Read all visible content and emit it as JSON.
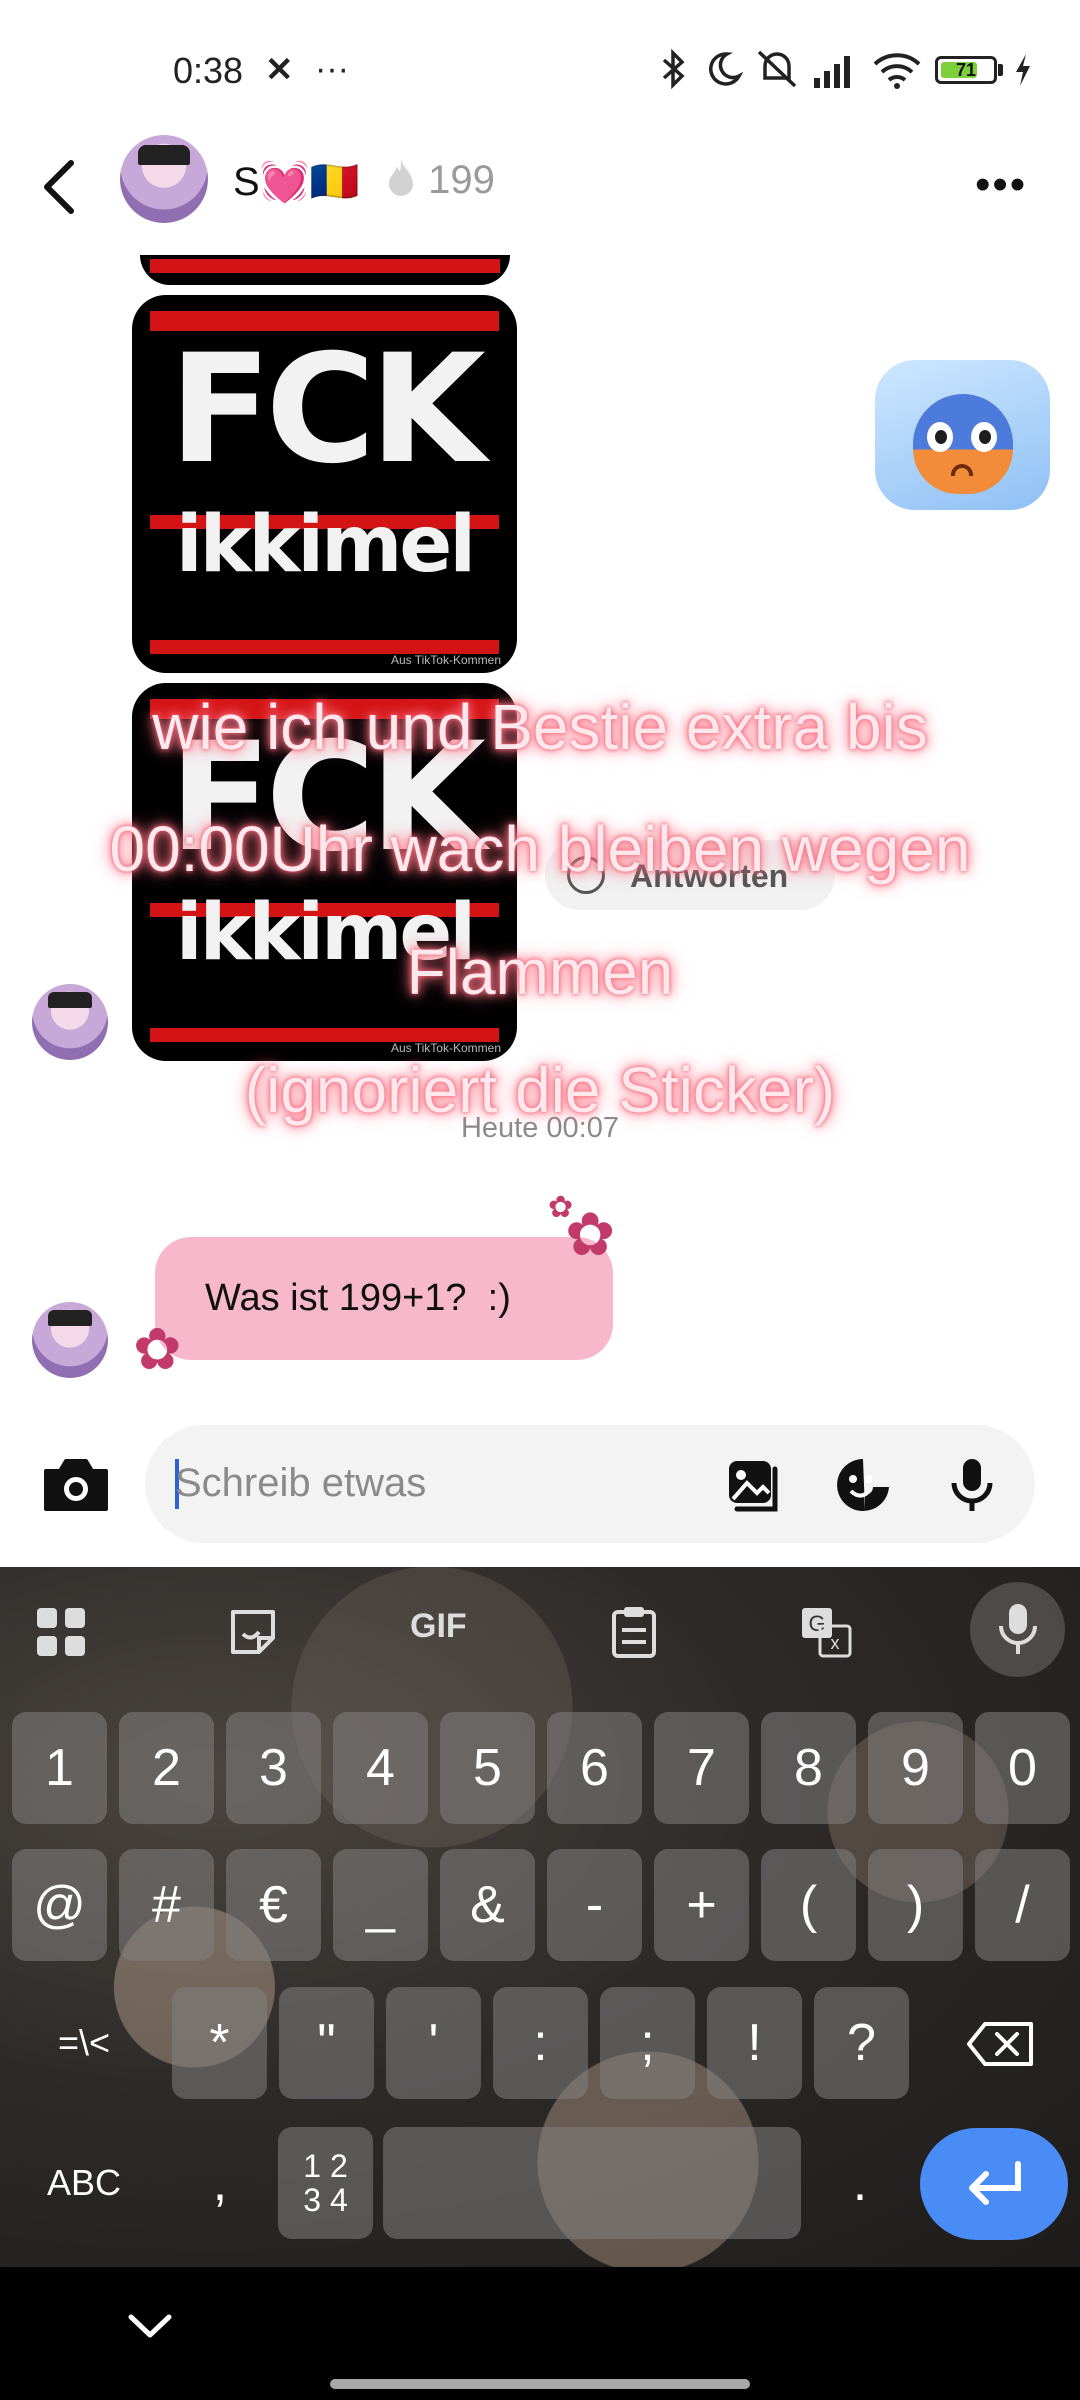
{
  "status_bar": {
    "time": "0:38",
    "battery_level": "71",
    "battery_fraction": 0.71,
    "icons": [
      "x-app-icon",
      "dots-icon",
      "bluetooth-icon",
      "moon-icon",
      "mute-icon",
      "signal-icon",
      "wifi-icon",
      "battery-icon",
      "charging-icon"
    ]
  },
  "header": {
    "name": "S💓🇷🇴",
    "streak_icon": "flame-icon",
    "streak_count": "199"
  },
  "messages": {
    "sticker_line1": "FCK",
    "sticker_line2": "ikkimel",
    "sticker_watermark": "Aus TikTok-Kommen",
    "reply_label": "Antworten",
    "timestamp": "Heute 00:07",
    "bubble_text": "Was ist 199+1?  :)"
  },
  "overlay": {
    "line1": "wie ich und Bestie extra bis",
    "line2": "00:00Uhr wach bleiben wegen",
    "line3": "Flammen",
    "line4": "(ignoriert die Sticker)"
  },
  "compose": {
    "placeholder": "Schreib etwas"
  },
  "keyboard": {
    "toolbar": [
      "apps-icon",
      "sticker-icon",
      "GIF",
      "clipboard-icon",
      "translate-icon",
      "mic-icon"
    ],
    "gif_label": "GIF",
    "row1": [
      "1",
      "2",
      "3",
      "4",
      "5",
      "6",
      "7",
      "8",
      "9",
      "0"
    ],
    "row2": [
      "@",
      "#",
      "€",
      "_",
      "&",
      "-",
      "+",
      "(",
      ")",
      "/"
    ],
    "row3": [
      "=\\<",
      "*",
      "\"",
      "'",
      ":",
      ";",
      "!",
      "?"
    ],
    "abc_label": "ABC",
    "comma_label": ",",
    "num_label_top": "1 2",
    "num_label_bottom": "3 4",
    "period_label": "."
  },
  "colors": {
    "bubble": "#f7b8cc",
    "accent": "#4a8cf5",
    "overlay_glow": "#ff6d80"
  }
}
